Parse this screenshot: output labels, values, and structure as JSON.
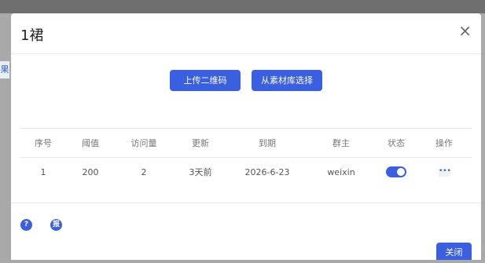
{
  "background": {
    "side_text": "果"
  },
  "modal": {
    "title": "1裙",
    "close_symbol": "×",
    "actions": {
      "upload_label": "上传二维码",
      "library_label": "从素材库选择"
    },
    "table": {
      "columns": [
        "序号",
        "阈值",
        "访问量",
        "更新",
        "到期",
        "群主",
        "状态",
        "操作"
      ],
      "rows": [
        {
          "index": "1",
          "threshold": "200",
          "visits": "2",
          "updated": "3天前",
          "expires": "2026-6-23",
          "owner": "weixin",
          "status_on": true,
          "ops": "•••"
        }
      ]
    },
    "footer": {
      "help_a": "?",
      "help_b": "报",
      "close_label": "关闭"
    }
  },
  "colors": {
    "accent": "#3a5fe0",
    "overlay": "#a9a9a9"
  }
}
